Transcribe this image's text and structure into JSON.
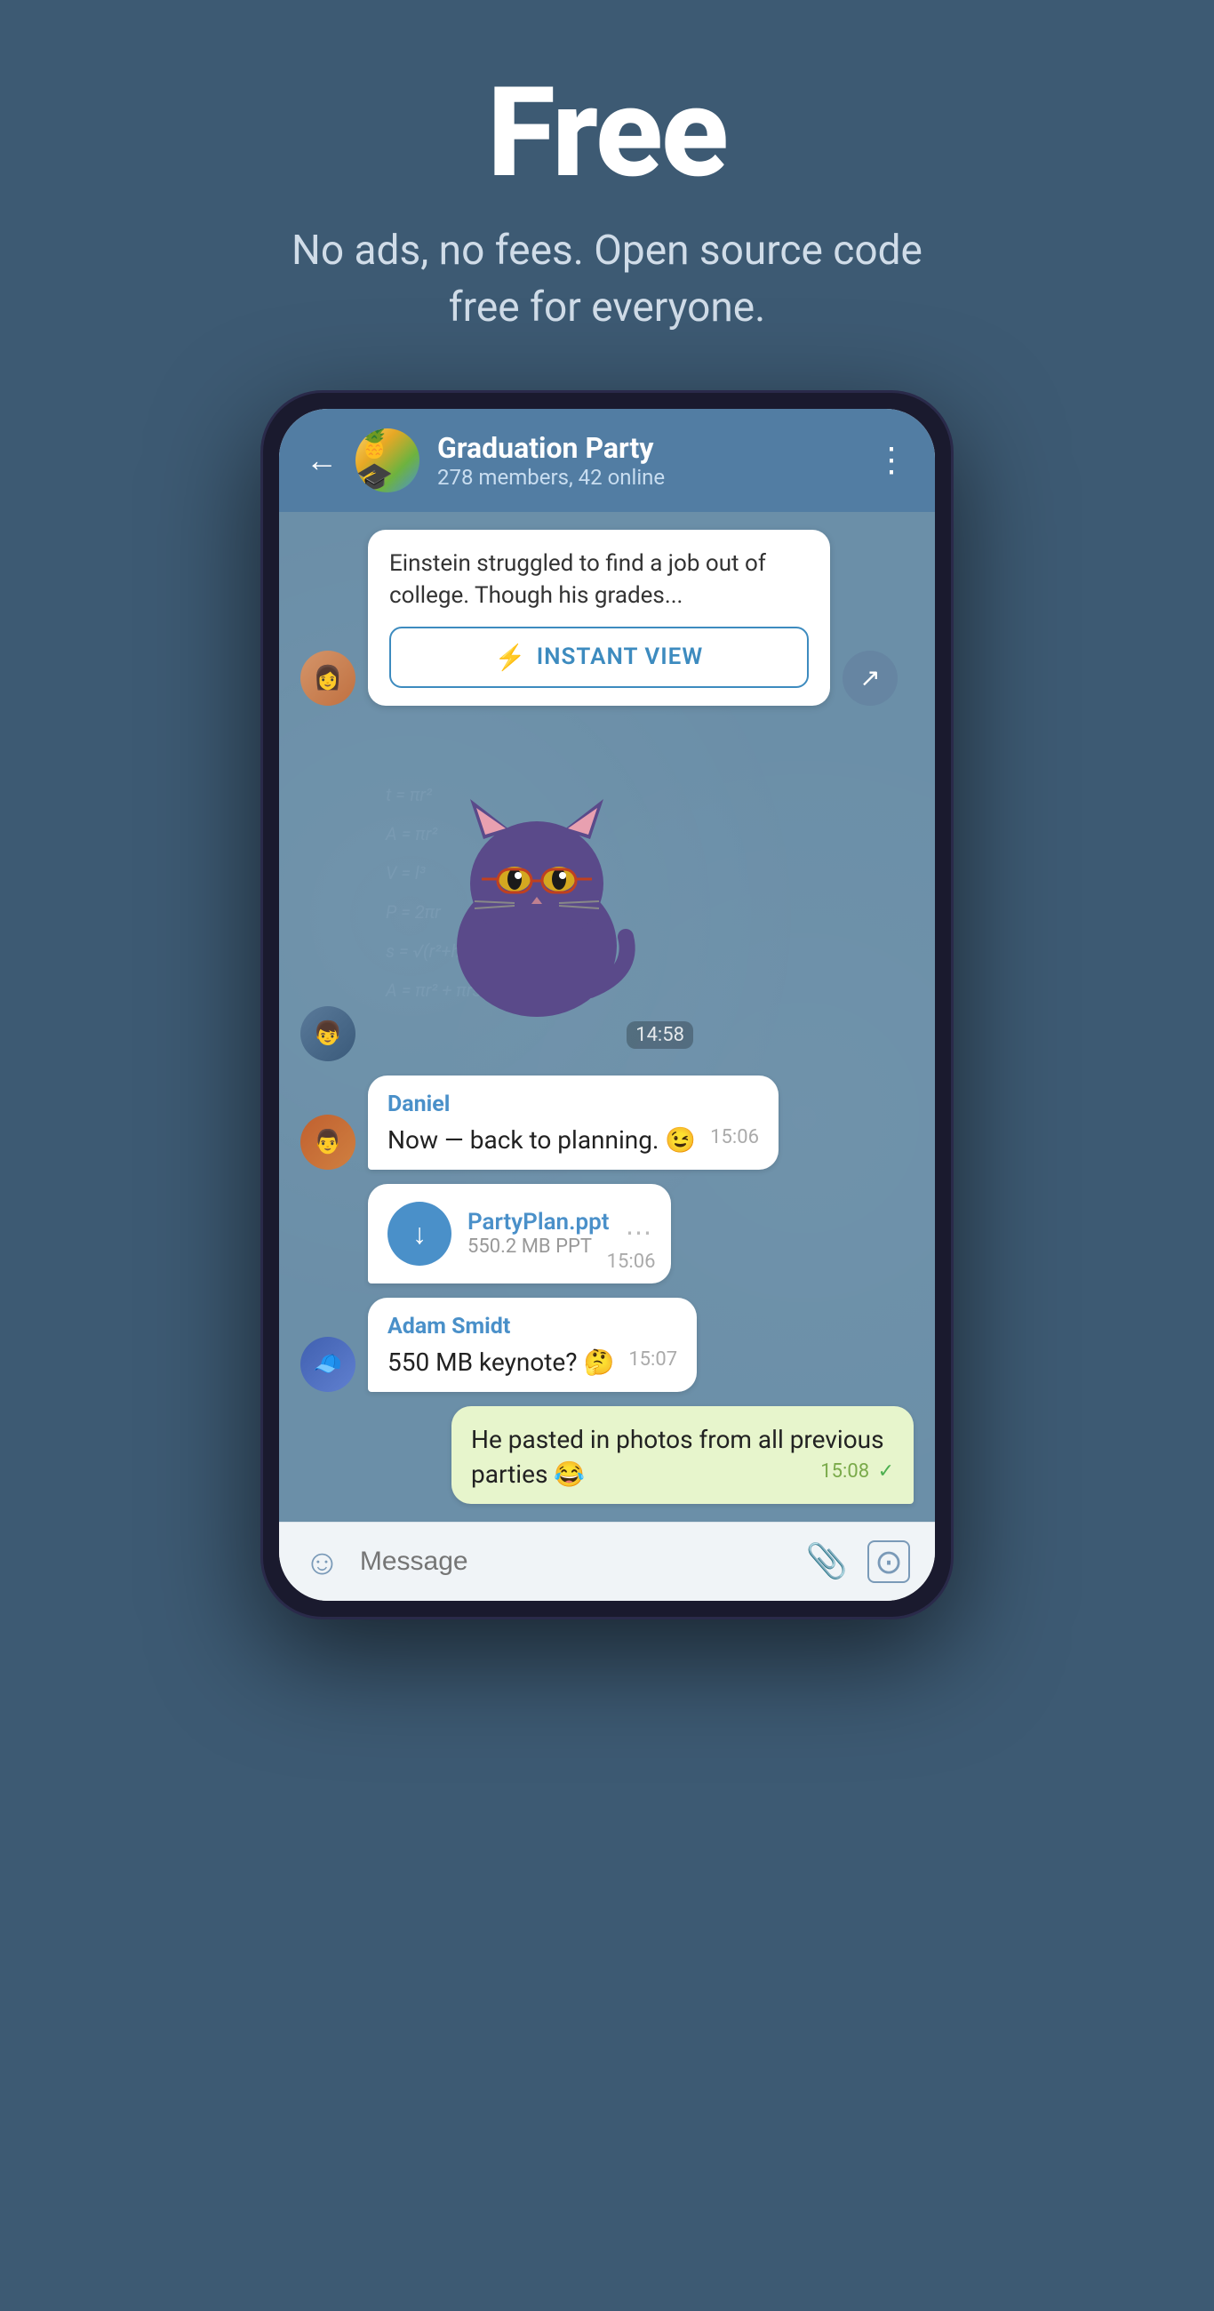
{
  "hero": {
    "title": "Free",
    "subtitle": "No ads, no fees. Open source code free for everyone."
  },
  "header": {
    "back_label": "←",
    "chat_name": "Graduation Party",
    "chat_members": "278 members, 42 online",
    "more_icon": "⋮",
    "avatar_emoji": "🍍"
  },
  "messages": [
    {
      "id": "link-preview",
      "type": "link",
      "preview_text": "Einstein struggled to find a job out of college. Though his grades...",
      "instant_view_label": "INSTANT VIEW"
    },
    {
      "id": "sticker",
      "type": "sticker",
      "time": "14:58"
    },
    {
      "id": "daniel-msg",
      "type": "text",
      "sender": "Daniel",
      "text": "Now — back to planning. 😉",
      "time": "15:06"
    },
    {
      "id": "file-msg",
      "type": "file",
      "file_name": "PartyPlan.ppt",
      "file_size": "550.2 MB PPT",
      "time": "15:06"
    },
    {
      "id": "adam-msg",
      "type": "text",
      "sender": "Adam Smidt",
      "text": "550 MB keynote? 🤔",
      "time": "15:07"
    },
    {
      "id": "own-msg",
      "type": "own",
      "text": "He pasted in photos from all previous parties 😂",
      "time": "15:08"
    }
  ],
  "input": {
    "placeholder": "Message"
  },
  "colors": {
    "bg": "#3d5a73",
    "header": "#527da3",
    "chat_bg": "#6b8fa8",
    "bubble_white": "#ffffff",
    "bubble_green": "#e7f5cc",
    "accent": "#4a90c9",
    "instant_view_color": "#3d8bbf"
  }
}
